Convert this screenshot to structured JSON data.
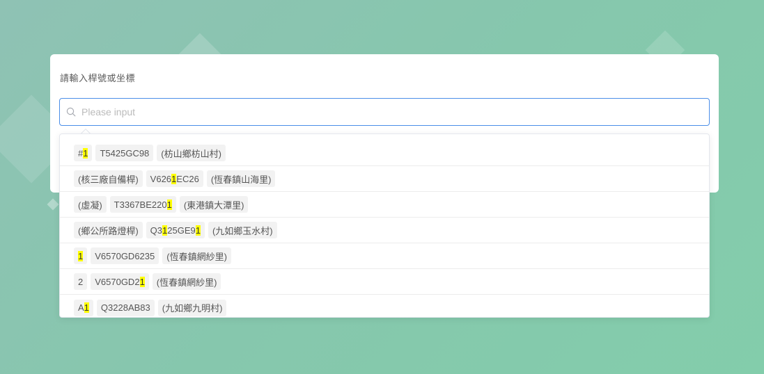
{
  "form": {
    "label": "請輸入桿號或坐標",
    "search": {
      "placeholder": "Please input",
      "value": ""
    }
  },
  "colors": {
    "accent": "#4a8ee8",
    "highlight": "#ffff00"
  },
  "results": [
    {
      "tags": [
        [
          [
            "#",
            ""
          ],
          [
            "1",
            "hl"
          ]
        ],
        [
          [
            "T5425GC98",
            ""
          ]
        ],
        [
          [
            "(枋山鄉枋山村)",
            ""
          ]
        ]
      ]
    },
    {
      "tags": [
        [
          [
            "(核三廠自備桿)",
            ""
          ]
        ],
        [
          [
            "V626",
            ""
          ],
          [
            "1",
            "hl"
          ],
          [
            "EC26",
            ""
          ]
        ],
        [
          [
            "(恆春鎮山海里)",
            ""
          ]
        ]
      ]
    },
    {
      "tags": [
        [
          [
            "(虛凝)",
            ""
          ]
        ],
        [
          [
            "T3367BE220",
            ""
          ],
          [
            "1",
            "hl"
          ]
        ],
        [
          [
            "(東港鎮大潭里)",
            ""
          ]
        ]
      ]
    },
    {
      "tags": [
        [
          [
            "(鄉公所路燈桿)",
            ""
          ]
        ],
        [
          [
            "Q3",
            ""
          ],
          [
            "1",
            "hl"
          ],
          [
            "25GE9",
            ""
          ],
          [
            "1",
            "hl"
          ]
        ],
        [
          [
            "(九如鄉玉水村)",
            ""
          ]
        ]
      ]
    },
    {
      "tags": [
        [
          [
            "1",
            "hl"
          ]
        ],
        [
          [
            "V6570GD6235",
            ""
          ]
        ],
        [
          [
            "(恆春鎮網紗里)",
            ""
          ]
        ]
      ]
    },
    {
      "tags": [
        [
          [
            "2",
            ""
          ]
        ],
        [
          [
            "V6570GD2",
            ""
          ],
          [
            "1",
            "hl"
          ]
        ],
        [
          [
            "(恆春鎮網紗里)",
            ""
          ]
        ]
      ]
    },
    {
      "tags": [
        [
          [
            "A",
            ""
          ],
          [
            "1",
            "hl"
          ]
        ],
        [
          [
            "Q3228AB83",
            ""
          ]
        ],
        [
          [
            "(九如鄉九明村)",
            ""
          ]
        ]
      ]
    }
  ]
}
